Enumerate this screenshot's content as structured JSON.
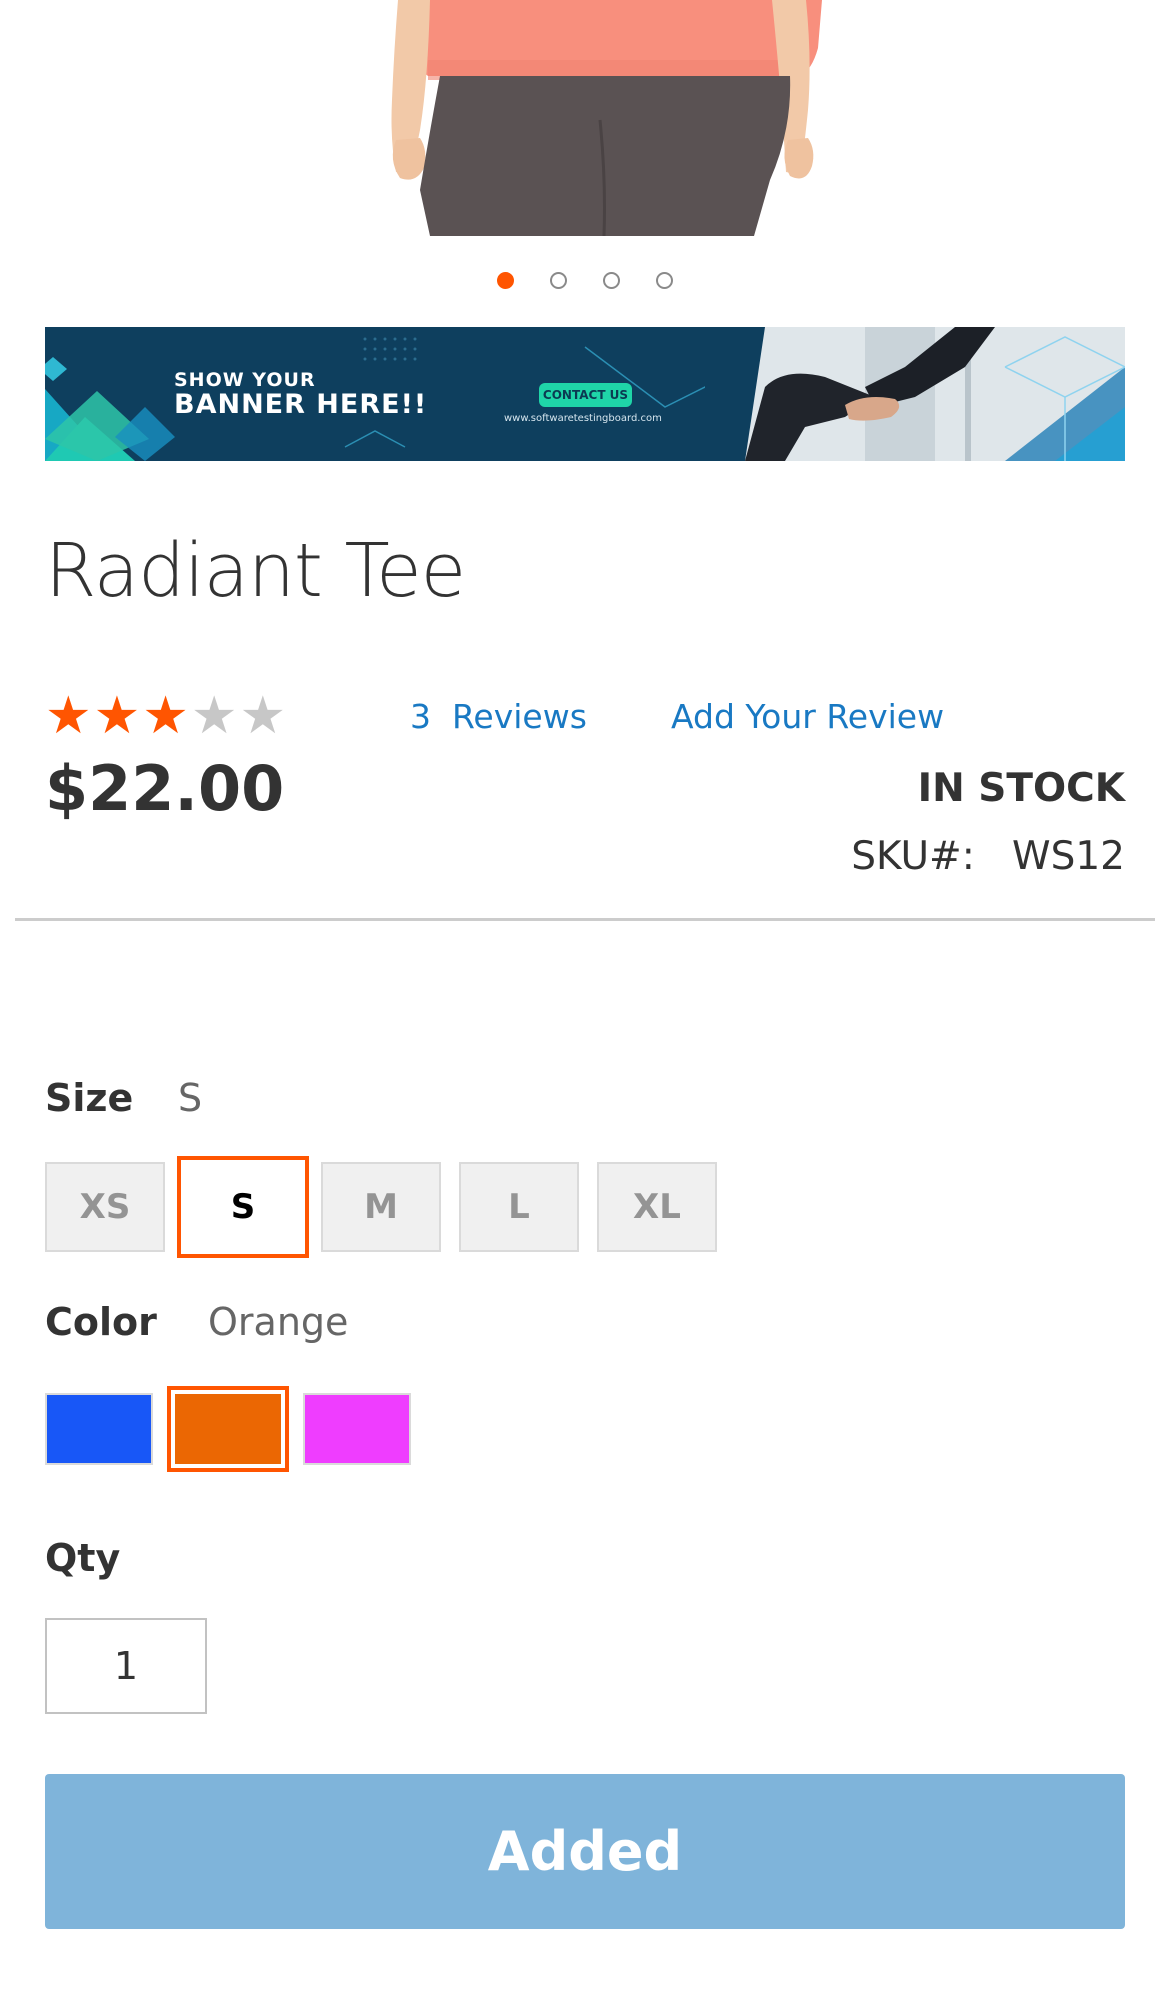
{
  "gallery": {
    "active_index": 0,
    "dot_count": 4
  },
  "banner": {
    "line1": "SHOW YOUR",
    "line2": "BANNER HERE!!",
    "cta": "CONTACT US",
    "url": "www.softwaretestingboard.com"
  },
  "product": {
    "title": "Radiant Tee",
    "rating": 3,
    "rating_max": 5,
    "reviews_count": "3",
    "reviews_label": "Reviews",
    "add_review_label": "Add Your Review",
    "price": "$22.00",
    "stock": "IN STOCK",
    "sku_label": "SKU#:",
    "sku_value": "WS12"
  },
  "options": {
    "size_label": "Size",
    "size_selected": "S",
    "sizes": [
      "XS",
      "S",
      "M",
      "L",
      "XL"
    ],
    "color_label": "Color",
    "color_selected": "Orange",
    "colors": [
      {
        "name": "Blue",
        "hex": "#1857f7"
      },
      {
        "name": "Orange",
        "hex": "#eb6703"
      },
      {
        "name": "Purple",
        "hex": "#ef3dff"
      }
    ]
  },
  "qty": {
    "label": "Qty",
    "value": "1"
  },
  "cart": {
    "button_label": "Added"
  },
  "theme": {
    "accent": "#ff5501",
    "link": "#1979c3",
    "button_disabled": "#7fb4da"
  }
}
